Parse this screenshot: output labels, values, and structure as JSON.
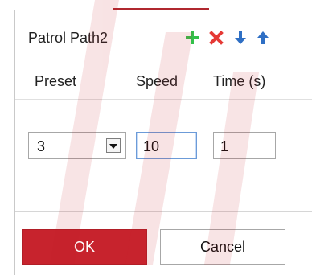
{
  "dialog": {
    "title": "Patrol Path2",
    "toolbar": {
      "add_icon": "plus-icon",
      "delete_icon": "x-icon",
      "down_icon": "arrow-down-icon",
      "up_icon": "arrow-up-icon",
      "colors": {
        "add": "#33c04a",
        "delete": "#e53935",
        "move": "#2f6fc4"
      }
    },
    "columns": {
      "preset": "Preset",
      "speed": "Speed",
      "time": "Time (s)"
    },
    "row": {
      "preset_value": "3",
      "speed_value": "10",
      "time_value": "1"
    },
    "buttons": {
      "ok": "OK",
      "cancel": "Cancel"
    }
  },
  "colors": {
    "accent_red": "#c7232d",
    "border": "#a7a7a7",
    "text": "#222222"
  }
}
